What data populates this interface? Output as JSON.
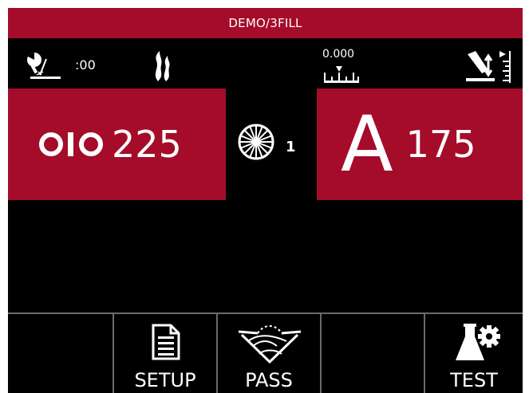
{
  "title": "DEMO/3FILL",
  "status": {
    "time_value": ":00",
    "gauge_value": "0.000",
    "icons": [
      "timer-arc-icon",
      "gas-flame-icon",
      "gauge-ruler-icon",
      "wire-height-adjust-icon"
    ]
  },
  "travel_speed": {
    "icon": "travel-speed-icon",
    "value": "225"
  },
  "pass_selector": {
    "icon": "pass-wheel-icon",
    "value": "1"
  },
  "amperage": {
    "letter": "A",
    "value": "175"
  },
  "footer": {
    "buttons": [
      {
        "label": ""
      },
      {
        "label": "SETUP",
        "icon": "document-icon"
      },
      {
        "label": "PASS",
        "icon": "weld-pass-icon"
      },
      {
        "label": ""
      },
      {
        "label": "TEST",
        "icon": "flask-gear-icon"
      }
    ]
  },
  "colors": {
    "accent": "#a50c2a",
    "background": "#000000",
    "divider": "#6a6a6a"
  }
}
